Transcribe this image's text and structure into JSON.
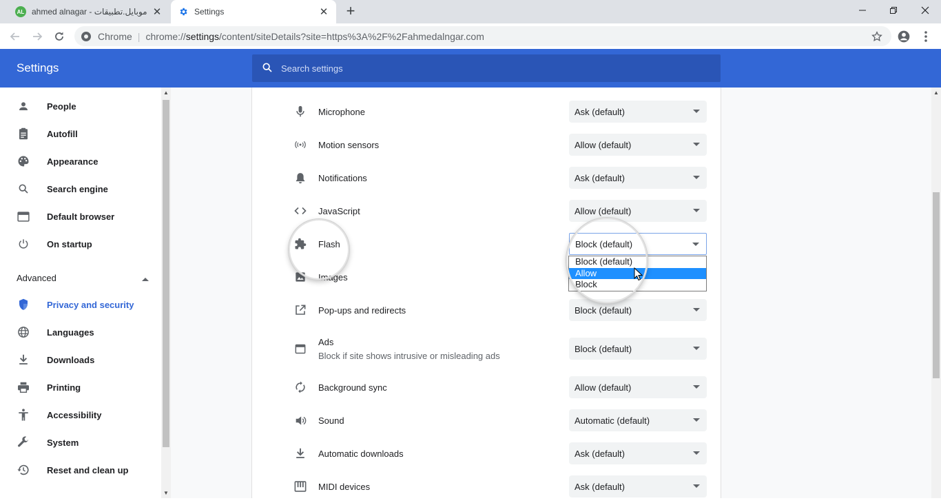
{
  "browser": {
    "tabs": [
      {
        "title": "ahmed alnagar - موبايل.تطبيقات",
        "favicon_text": "AL",
        "active": false
      },
      {
        "title": "Settings",
        "active": true
      }
    ],
    "omnibox": {
      "chip": "Chrome",
      "url_prefix": "chrome://",
      "url_main": "settings",
      "url_rest": "/content/siteDetails?site=https%3A%2F%2Fahmedalngar.com"
    }
  },
  "header": {
    "title": "Settings",
    "search_placeholder": "Search settings"
  },
  "sidebar": {
    "items": [
      {
        "label": "People",
        "icon": "person-icon"
      },
      {
        "label": "Autofill",
        "icon": "clipboard-icon"
      },
      {
        "label": "Appearance",
        "icon": "palette-icon"
      },
      {
        "label": "Search engine",
        "icon": "search-icon"
      },
      {
        "label": "Default browser",
        "icon": "browser-window-icon"
      },
      {
        "label": "On startup",
        "icon": "power-icon"
      }
    ],
    "advanced_label": "Advanced",
    "advanced_items": [
      {
        "label": "Privacy and security",
        "icon": "shield-icon",
        "active": true
      },
      {
        "label": "Languages",
        "icon": "globe-icon"
      },
      {
        "label": "Downloads",
        "icon": "download-icon"
      },
      {
        "label": "Printing",
        "icon": "printer-icon"
      },
      {
        "label": "Accessibility",
        "icon": "accessibility-icon"
      },
      {
        "label": "System",
        "icon": "wrench-icon"
      },
      {
        "label": "Reset and clean up",
        "icon": "history-icon"
      }
    ]
  },
  "permissions": [
    {
      "label": "Microphone",
      "value": "Ask (default)",
      "icon": "microphone-icon"
    },
    {
      "label": "Motion sensors",
      "value": "Allow (default)",
      "icon": "sensors-icon"
    },
    {
      "label": "Notifications",
      "value": "Ask (default)",
      "icon": "bell-icon"
    },
    {
      "label": "JavaScript",
      "value": "Allow (default)",
      "icon": "code-icon"
    },
    {
      "label": "Flash",
      "value": "Block (default)",
      "icon": "puzzle-icon"
    },
    {
      "label": "Images",
      "value": "",
      "icon": "image-icon"
    },
    {
      "label": "Pop-ups and redirects",
      "value": "Block (default)",
      "icon": "open-in-new-icon"
    },
    {
      "label": "Ads",
      "sublabel": "Block if site shows intrusive or misleading ads",
      "value": "Block (default)",
      "icon": "ads-window-icon"
    },
    {
      "label": "Background sync",
      "value": "Allow (default)",
      "icon": "sync-icon"
    },
    {
      "label": "Sound",
      "value": "Automatic (default)",
      "icon": "speaker-icon"
    },
    {
      "label": "Automatic downloads",
      "value": "Ask (default)",
      "icon": "download-icon"
    },
    {
      "label": "MIDI devices",
      "value": "Ask (default)",
      "icon": "piano-icon"
    }
  ],
  "flash_dropdown": {
    "options": [
      "Block (default)",
      "Allow",
      "Block"
    ],
    "highlighted": "Allow"
  },
  "colors": {
    "accent": "#3367d6",
    "highlight": "#1e90ff"
  }
}
